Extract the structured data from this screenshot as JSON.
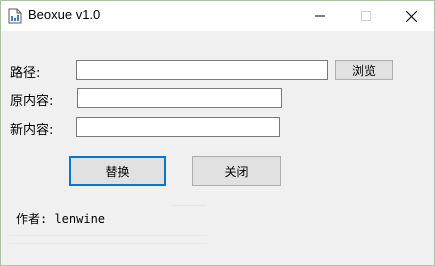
{
  "window": {
    "title": "Beoxue v1.0",
    "controls": {
      "minimize": "minimize-icon",
      "maximize": "maximize-icon",
      "close": "close-icon"
    }
  },
  "form": {
    "path_label": "路径:",
    "path_value": "",
    "browse_label": "浏览",
    "original_label": "原内容:",
    "original_value": "",
    "new_label": "新内容:",
    "new_value": ""
  },
  "actions": {
    "replace_label": "替换",
    "close_label": "关闭"
  },
  "footer": {
    "author_text": "作者: lenwine"
  },
  "colors": {
    "accent": "#0078d7",
    "window_bg": "#f0f0f0",
    "titlebar_bg": "#ffffff",
    "button_bg": "#e1e1e1"
  }
}
